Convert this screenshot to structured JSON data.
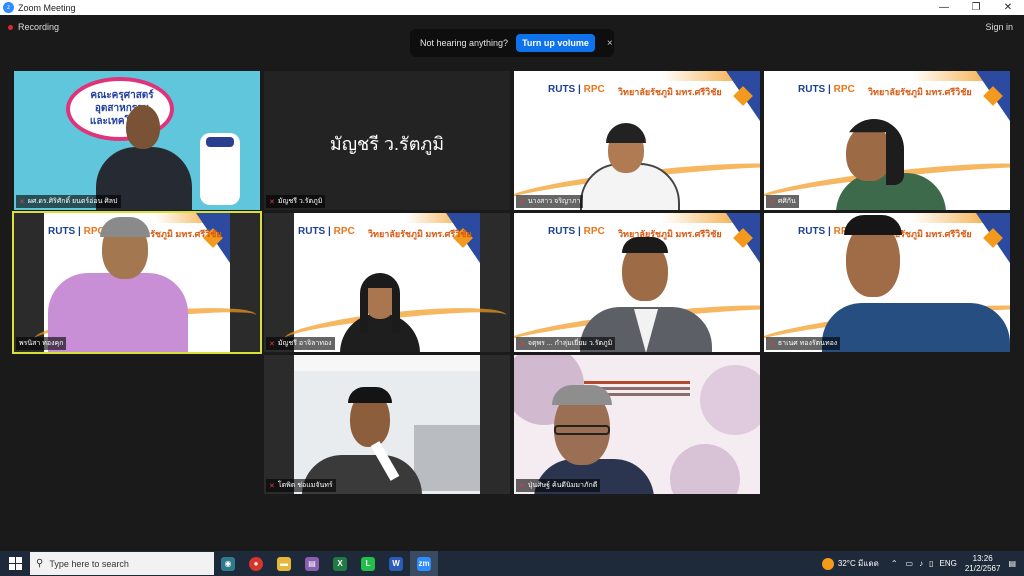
{
  "window": {
    "title": "Zoom Meeting",
    "minimize": "—",
    "restore": "❐",
    "close": "✕"
  },
  "topbar": {
    "recording": "Recording",
    "banner_text": "Not hearing anything?",
    "banner_button": "Turn up volume",
    "banner_close": "×",
    "signin": "Sign in"
  },
  "tiles": [
    {
      "name": "ผศ.ดร.ศิริศักดิ์ ยนตร์อ่อน ศิลป"
    },
    {
      "name": "มัญชรี ว.รัตภูมิ",
      "center_text": "มัญชรี ว.รัตภูมิ"
    },
    {
      "name": "นางสาว จริญาภา"
    },
    {
      "name": "ศศิกัน"
    },
    {
      "name": "พรนิสา ทองคุก"
    },
    {
      "name": "มัญชรี อาจิลาทอง"
    },
    {
      "name": "จตุพร ... กำลุ่มเยี่ยม ว.รัตภูมิ"
    },
    {
      "name": "ธาเนศ ทองรัตนทอง"
    },
    {
      "name": "โตพิต ช่อแมจันทร์"
    },
    {
      "name": "ปุ่นศิษฐ์ ค้นดีนิมมาภักดี"
    }
  ],
  "banner": {
    "logo_a": "RUTS",
    "logo_b": "RPC",
    "thai": "วิทยาลัยรัชภูมิ มทร.ศรีวิชัย"
  },
  "faculty_banner": {
    "line1": "คณะครุศาสตร์",
    "line2": "อุตสาหกรรม",
    "line3": "และเทคโนโลยี"
  },
  "taskbar": {
    "search_placeholder": "Type here to search",
    "weather": "32°C มีแดด",
    "lang": "ENG",
    "time": "13:26",
    "date": "21/2/2567"
  }
}
